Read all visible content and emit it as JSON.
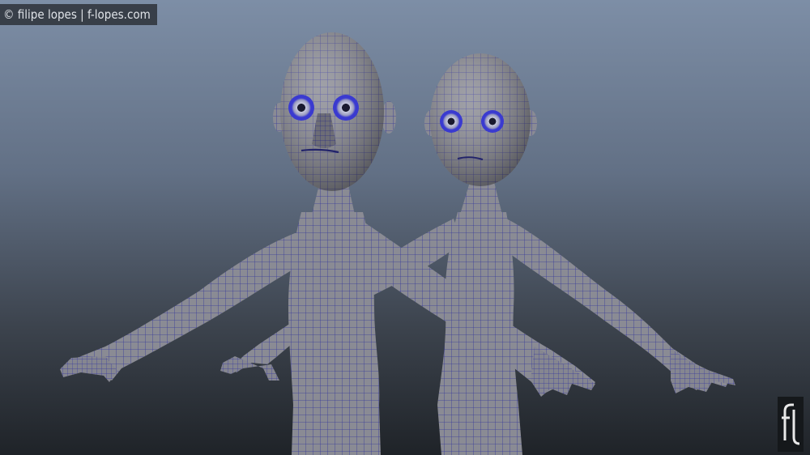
{
  "credit_text": "© filipe lopes  |  f-lopes.com",
  "logo_text": "fl",
  "colors": {
    "background_top": "#7d8ea6",
    "background_bottom": "#1f2328",
    "mesh_skin": "#8b8c95",
    "wireframe": "#2a2a9a",
    "eye_iris": "#3a3ad0"
  }
}
